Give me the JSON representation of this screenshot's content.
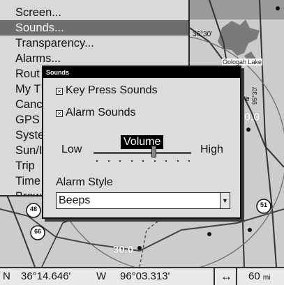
{
  "menu": {
    "items": [
      {
        "label": "Screen..."
      },
      {
        "label": "Sounds..."
      },
      {
        "label": "Transparency..."
      },
      {
        "label": "Alarms..."
      },
      {
        "label": "Rout"
      },
      {
        "label": "My T"
      },
      {
        "label": "Canc"
      },
      {
        "label": "GPS"
      },
      {
        "label": "Syste"
      },
      {
        "label": "Sun/I"
      },
      {
        "label": "Trip"
      },
      {
        "label": "Time"
      },
      {
        "label": "Brow"
      }
    ],
    "selected_index": 1
  },
  "dialog": {
    "title": "Sounds",
    "key_press_sounds": {
      "label": "Key Press Sounds",
      "checked": true,
      "mark": "×"
    },
    "alarm_sounds": {
      "label": "Alarm Sounds",
      "checked": true,
      "mark": "×"
    },
    "volume": {
      "label": "Volume",
      "low_label": "Low",
      "high_label": "High",
      "level_fraction": 0.62
    },
    "alarm_style": {
      "label": "Alarm Style",
      "value": "Beeps",
      "arrow": "▼"
    }
  },
  "map": {
    "labels": {
      "lat_marker": "36°30'",
      "lake": "Oologah Lake",
      "route_48": "48",
      "route_66": "66",
      "route_51": "51",
      "circle_range": "30.0",
      "right_range": "0.0",
      "right_text": "re",
      "vertical_coord": "95°30'"
    }
  },
  "statusbar": {
    "lat_hemisphere": "N",
    "latitude": "36°14.646'",
    "lon_hemisphere": "W",
    "longitude": "96°03.313'",
    "range_icon": "↔",
    "range_value": "60",
    "range_unit": "mi"
  },
  "colors": {
    "selection": "#6d6d6d",
    "dialog_titlebar": "#000000",
    "water": "#7a7a7a"
  }
}
